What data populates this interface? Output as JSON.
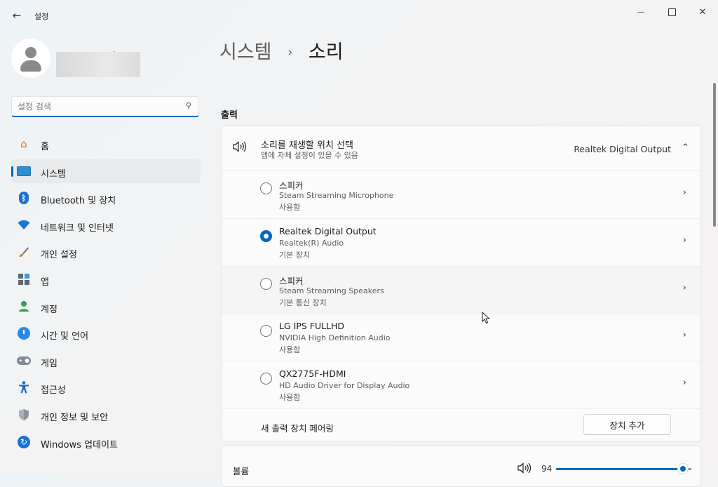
{
  "window": {
    "title": "설정",
    "back_icon": "←",
    "minimize_icon": "—",
    "close_icon": "✕"
  },
  "profile": {
    "mark": "."
  },
  "search": {
    "placeholder": "설정 검색",
    "value": ""
  },
  "sidebar": {
    "items": [
      {
        "label": "홈",
        "icon": "home-icon"
      },
      {
        "label": "시스템",
        "icon": "monitor-icon",
        "active": true
      },
      {
        "label": "Bluetooth 및 장치",
        "icon": "bluetooth-icon"
      },
      {
        "label": "네트워크 및 인터넷",
        "icon": "wifi-icon"
      },
      {
        "label": "개인 설정",
        "icon": "paintbrush-icon"
      },
      {
        "label": "앱",
        "icon": "apps-icon"
      },
      {
        "label": "계정",
        "icon": "account-icon"
      },
      {
        "label": "시간 및 언어",
        "icon": "clock-globe-icon"
      },
      {
        "label": "게임",
        "icon": "gamepad-icon"
      },
      {
        "label": "접근성",
        "icon": "accessibility-icon"
      },
      {
        "label": "개인 정보 및 보안",
        "icon": "shield-icon"
      },
      {
        "label": "Windows 업데이트",
        "icon": "update-icon"
      }
    ]
  },
  "breadcrumb": {
    "parent": "시스템",
    "separator": "›",
    "current": "소리"
  },
  "output": {
    "section_title": "출력",
    "header": {
      "title": "소리를 재생할 위치 선택",
      "subtitle": "앱에 자체 설정이 있을 수 있음",
      "value": "Realtek Digital Output"
    },
    "devices": [
      {
        "name": "스피커",
        "driver": "Steam Streaming Microphone",
        "status": "사용함",
        "selected": false
      },
      {
        "name": "Realtek Digital Output",
        "driver": "Realtek(R) Audio",
        "status": "기본 장치",
        "selected": true
      },
      {
        "name": "스피커",
        "driver": "Steam Streaming Speakers",
        "status": "기본 통신 장치",
        "selected": false
      },
      {
        "name": "LG IPS FULLHD",
        "driver": "NVIDIA High Definition Audio",
        "status": "사용함",
        "selected": false
      },
      {
        "name": "QX2775F-HDMI",
        "driver": "HD Audio Driver for Display Audio",
        "status": "사용함",
        "selected": false
      }
    ],
    "pair_label": "새 출력 장치 페어링",
    "add_button": "장치 추가"
  },
  "volume": {
    "label": "볼륨",
    "value": 94
  },
  "colors": {
    "accent": "#0067c0"
  }
}
